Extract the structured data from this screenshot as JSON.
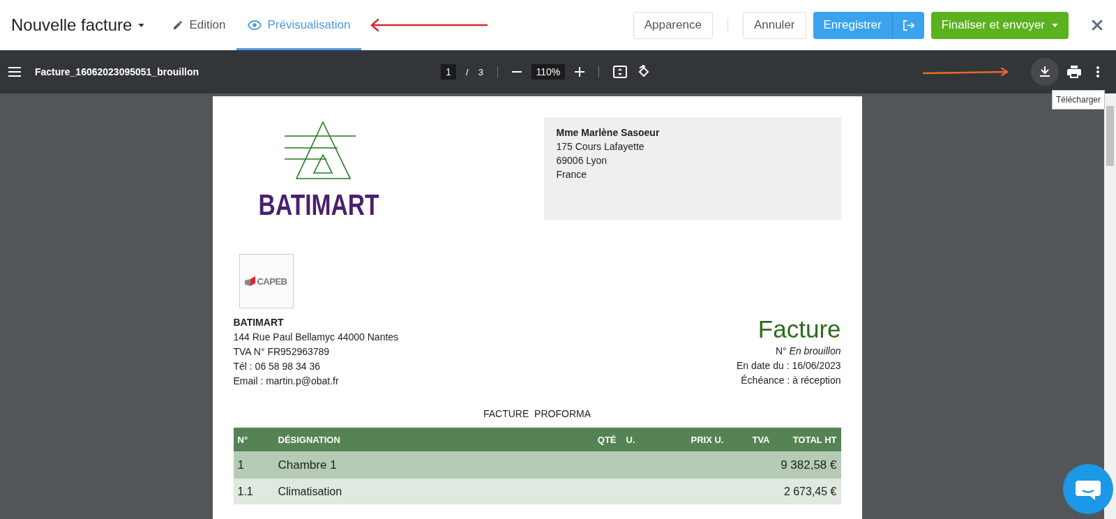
{
  "header": {
    "title": "Nouvelle facture",
    "tabs": [
      {
        "label": "Edition",
        "kind": "pencil",
        "selected": false
      },
      {
        "label": "Prévisualisation",
        "kind": "eye",
        "selected": true
      }
    ],
    "buttons": [
      {
        "label": "Apparence",
        "kind": "outline"
      },
      {
        "label": "Annuler",
        "kind": "outline"
      },
      {
        "label": "Enregistrer",
        "kind": "primary"
      },
      {
        "label": "Finaliser et envoyer",
        "kind": "success"
      }
    ]
  },
  "viewer": {
    "filename": "Facture_16062023095051_brouillon",
    "page_current": "1",
    "page_separator": "/",
    "page_total": "3",
    "zoom": "110%",
    "tooltip": "Télécharger"
  },
  "document": {
    "logo_text": "BATIMART",
    "badge_text": "CAPEB",
    "recipient": [
      "Mme Marlène Sasoeur",
      "175 Cours Lafayette",
      "69006 Lyon",
      "France"
    ],
    "company": [
      "BATIMART",
      "144 Rue Paul Bellamyc 44000 Nantes",
      "TVA N° FR952963789",
      "Tél : 06 58 98 34 36",
      "Email : martin.p@obat.fr"
    ],
    "invoice_title": "Facture",
    "meta": [
      "N° *En brouillon*",
      "En date du : 16/06/2023",
      "Échéance : à réception"
    ],
    "heading": "FACTURE  PROFORMA",
    "table": {
      "columns": [
        "N°",
        "DÉSIGNATION",
        "QTÉ",
        "U.",
        "PRIX U.",
        "TVA",
        "TOTAL HT"
      ],
      "rows": [
        {
          "kind": "section",
          "number": "1",
          "designation": "Chambre 1",
          "total": "9 382,58 €"
        },
        {
          "kind": "subsection",
          "number": "1.1",
          "designation": "Climatisation",
          "total": "2 673,45 €"
        }
      ]
    }
  }
}
